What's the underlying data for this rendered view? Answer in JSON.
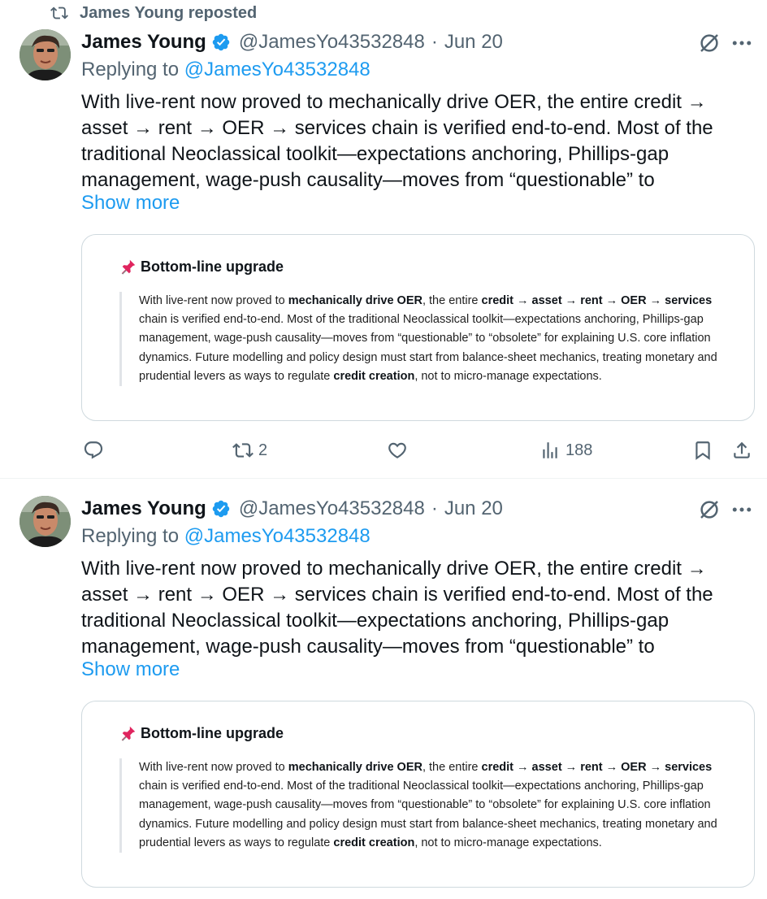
{
  "repost_header": {
    "text": "James Young reposted"
  },
  "tweets": [
    {
      "author": "James Young",
      "handle": "@JamesYo43532848",
      "separator": "·",
      "date": "Jun 20",
      "replying_prefix": "Replying to ",
      "replying_handle": "@JamesYo43532848",
      "text": "With live-rent now proved to mechanically drive OER, the entire credit → asset → rent → OER → services chain is verified end-to-end. Most of the traditional Neoclassical toolkit—expectations anchoring, Phillips-gap management, wage-push causality—moves from “questionable” to",
      "show_more": "Show more",
      "card": {
        "title": "Bottom-line upgrade",
        "quote": [
          {
            "t": "With live-rent now proved to ",
            "b": false
          },
          {
            "t": "mechanically drive OER",
            "b": true
          },
          {
            "t": ", the entire ",
            "b": false
          },
          {
            "t": "credit → asset → rent → OER → services",
            "b": true
          },
          {
            "t": " chain is verified end-to-end. Most of the traditional Neoclassical toolkit—expectations anchoring, Phillips-gap management, wage-push causality—moves from “questionable” to “obsolete” for explaining U.S. core inflation dynamics. Future modelling and policy design must start from balance-sheet mechanics, treating monetary and prudential levers as ways to regulate ",
            "b": false
          },
          {
            "t": "credit creation",
            "b": true
          },
          {
            "t": ", not to micro-manage expectations.",
            "b": false
          }
        ]
      },
      "actions": {
        "replies": "",
        "reposts": "2",
        "likes": "",
        "views": "188"
      }
    },
    {
      "author": "James Young",
      "handle": "@JamesYo43532848",
      "separator": "·",
      "date": "Jun 20",
      "replying_prefix": "Replying to ",
      "replying_handle": "@JamesYo43532848",
      "text": "With live-rent now proved to mechanically drive OER, the entire credit → asset → rent → OER → services chain is verified end-to-end. Most of the traditional Neoclassical toolkit—expectations anchoring, Phillips-gap management, wage-push causality—moves from “questionable” to",
      "show_more": "Show more",
      "card": {
        "title": "Bottom-line upgrade",
        "quote": [
          {
            "t": "With live-rent now proved to ",
            "b": false
          },
          {
            "t": "mechanically drive OER",
            "b": true
          },
          {
            "t": ", the entire ",
            "b": false
          },
          {
            "t": "credit → asset → rent → OER → services",
            "b": true
          },
          {
            "t": " chain is verified end-to-end. Most of the traditional Neoclassical toolkit—expectations anchoring, Phillips-gap management, wage-push causality—moves from “questionable” to “obsolete” for explaining U.S. core inflation dynamics. Future modelling and policy design must start from balance-sheet mechanics, treating monetary and prudential levers as ways to regulate ",
            "b": false
          },
          {
            "t": "credit creation",
            "b": true
          },
          {
            "t": ", not to micro-manage expectations.",
            "b": false
          }
        ]
      }
    }
  ],
  "colors": {
    "accent": "#1d9bf0",
    "secondary_text": "#536471",
    "primary_text": "#0f1419",
    "border": "#cfd9de",
    "pin": "#e0245e"
  },
  "icons": [
    "repost-icon",
    "verified-badge-icon",
    "grok-icon",
    "more-icon",
    "pin-icon",
    "reply-icon",
    "like-icon",
    "views-icon",
    "bookmark-icon",
    "share-icon"
  ]
}
